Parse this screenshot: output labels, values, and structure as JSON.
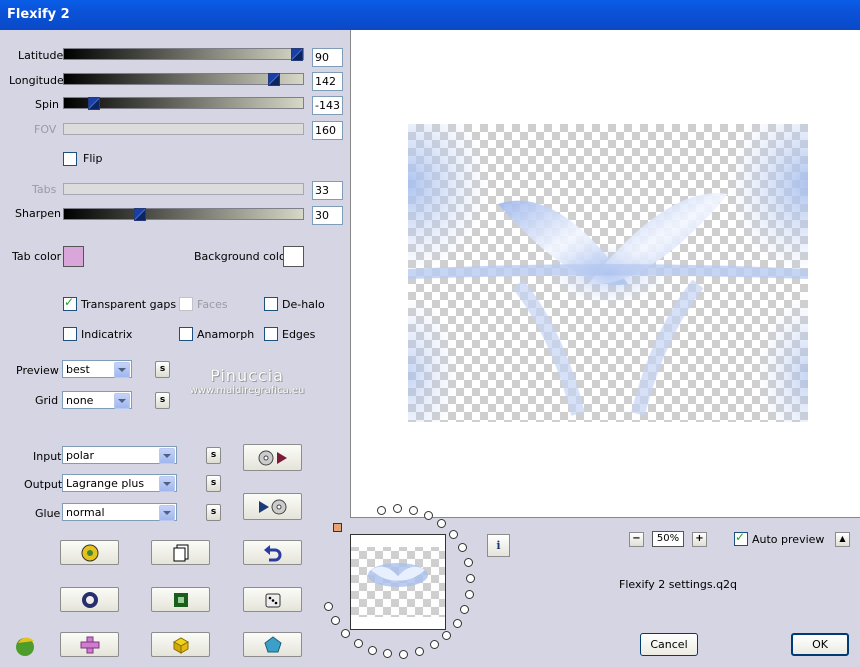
{
  "window": {
    "title": "Flexify 2"
  },
  "sliders": [
    {
      "label": "Latitude",
      "value": "90",
      "enabled": true,
      "fraction": 0.97
    },
    {
      "label": "Longitude",
      "value": "142",
      "enabled": true,
      "fraction": 0.88
    },
    {
      "label": "Spin",
      "value": "-143",
      "enabled": true,
      "fraction": 0.11
    },
    {
      "label": "FOV",
      "value": "160",
      "enabled": false
    },
    {
      "label": "Tabs",
      "value": "33",
      "enabled": false
    },
    {
      "label": "Sharpen",
      "value": "30",
      "enabled": true,
      "fraction": 0.3
    }
  ],
  "flip": {
    "label": "Flip",
    "checked": false
  },
  "tab_color": {
    "label": "Tab color",
    "color": "#d8a6d8"
  },
  "background_color": {
    "label": "Background color",
    "color": "#ffffff"
  },
  "options": {
    "transparent_gaps": {
      "label": "Transparent gaps",
      "checked": true
    },
    "faces": {
      "label": "Faces",
      "checked": false,
      "enabled": false
    },
    "de_halo": {
      "label": "De-halo",
      "checked": false
    },
    "indicatrix": {
      "label": "Indicatrix",
      "checked": false
    },
    "anamorph": {
      "label": "Anamorph",
      "checked": false
    },
    "edges": {
      "label": "Edges",
      "checked": false
    }
  },
  "preview": {
    "label": "Preview",
    "value": "best",
    "s_label": "s"
  },
  "grid": {
    "label": "Grid",
    "value": "none",
    "s_label": "s"
  },
  "input": {
    "label": "Input",
    "value": "polar",
    "s_label": "s"
  },
  "output": {
    "label": "Output",
    "value": "Lagrange plus",
    "s_label": "s"
  },
  "glue": {
    "label": "Glue",
    "value": "normal",
    "s_label": "s"
  },
  "watermark": {
    "line1": "Pinuccia",
    "line2": "www.maidiregrafica.eu"
  },
  "zoom": {
    "minus": "−",
    "value": "50%",
    "plus": "+"
  },
  "auto_preview": {
    "label": "Auto preview",
    "checked": true,
    "button": "▲"
  },
  "settings_file": "Flexify 2 settings.q2q",
  "buttons": {
    "cancel": "Cancel",
    "ok": "OK",
    "info": "i"
  },
  "colors": {
    "accent": "#0b52d8",
    "preview_tint": "#c8d6f4"
  }
}
